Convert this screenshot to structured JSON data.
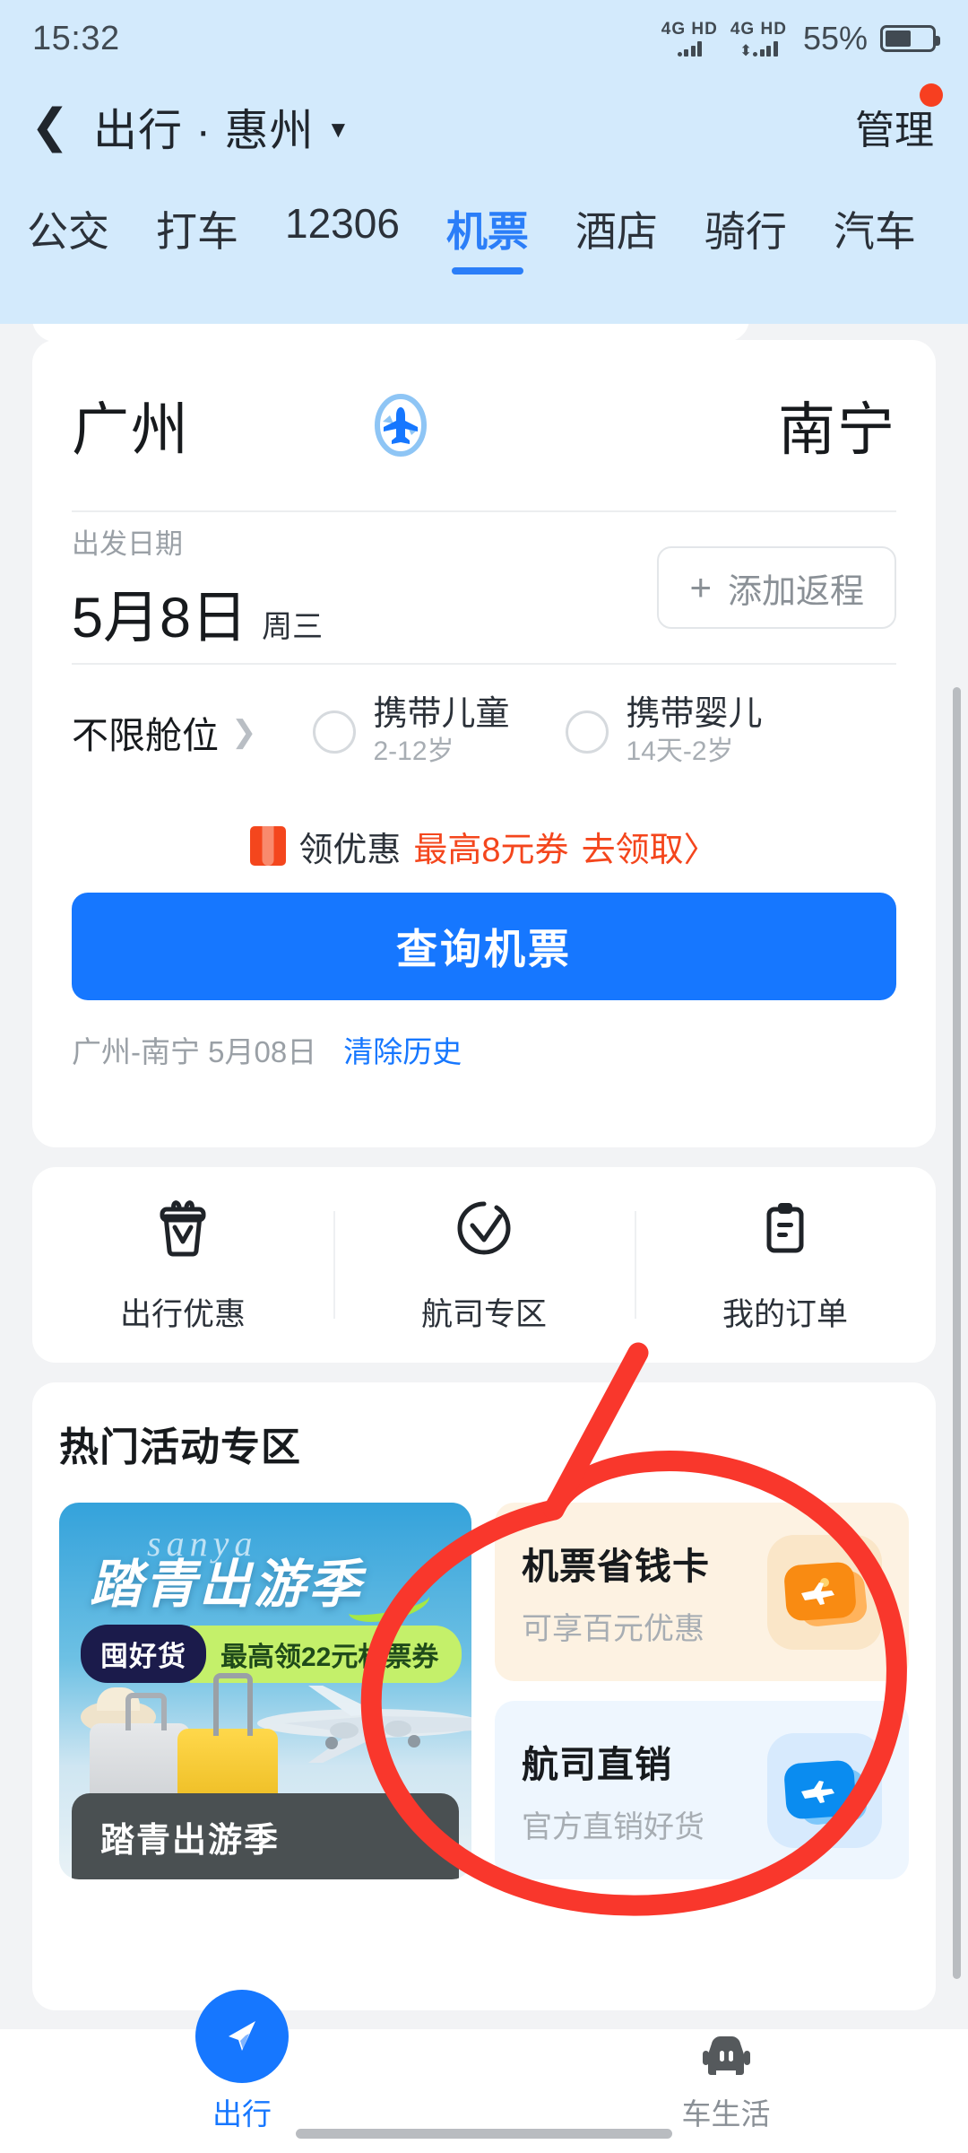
{
  "status_bar": {
    "time": "15:32",
    "signal_1": "4G HD",
    "signal_2": "4G HD",
    "battery_percent": "55%"
  },
  "header": {
    "back_icon": "chevron-left-icon",
    "title": "出行 · 惠州",
    "caret_icon": "caret-down-icon",
    "manage_label": "管理",
    "badge_color": "#f73f20"
  },
  "tabs": [
    {
      "label": "公交",
      "active": false
    },
    {
      "label": "打车",
      "active": false
    },
    {
      "label": "12306",
      "active": false
    },
    {
      "label": "机票",
      "active": true
    },
    {
      "label": "酒店",
      "active": false
    },
    {
      "label": "骑行",
      "active": false
    },
    {
      "label": "汽车",
      "active": false
    }
  ],
  "search_card": {
    "from_city": "广州",
    "to_city": "南宁",
    "swap_icon": "plane-swap-icon",
    "depart_label": "出发日期",
    "depart_date": "5月8日",
    "depart_weekday": "周三",
    "add_return_label": "添加返程",
    "add_return_icon": "plus-icon",
    "cabin_label": "不限舱位",
    "cabin_chevron": "chevron-right-icon",
    "child": {
      "title": "携带儿童",
      "sub": "2-12岁",
      "checked": false
    },
    "infant": {
      "title": "携带婴儿",
      "sub": "14天-2岁",
      "checked": false
    },
    "coupon": {
      "icon": "coupon-ticket-icon",
      "text": "领优惠",
      "highlight": "最高8元券",
      "action": "去领取〉"
    },
    "search_button": "查询机票",
    "history_text": "广州-南宁 5月08日",
    "history_clear": "清除历史",
    "primary_color": "#1677ff"
  },
  "quick_actions": [
    {
      "label": "出行优惠",
      "icon": "gift-box-icon"
    },
    {
      "label": "航司专区",
      "icon": "check-badge-icon"
    },
    {
      "label": "我的订单",
      "icon": "clipboard-icon"
    }
  ],
  "hot_section": {
    "title": "热门活动专区",
    "promo": {
      "script_text": "sanya",
      "headline": "踏青出游季",
      "badge_dark": "囤好货",
      "badge_green": "最高领22元机票券",
      "footer_title": "踏青出游季"
    },
    "mini_cards": [
      {
        "title": "机票省钱卡",
        "subtitle": "可享百元优惠",
        "icon": "plane-card-orange-icon",
        "bg": "#fdf2e2"
      },
      {
        "title": "航司直销",
        "subtitle": "官方直销好货",
        "icon": "plane-card-blue-icon",
        "bg": "#eef6fe"
      }
    ]
  },
  "bottom_nav": [
    {
      "label": "出行",
      "icon": "navigation-arrow-icon",
      "active": true
    },
    {
      "label": "车生活",
      "icon": "car-icon",
      "active": false
    }
  ],
  "annotation": {
    "type": "hand-drawn-circle",
    "color": "#f9372c",
    "target": "机票省钱卡"
  }
}
